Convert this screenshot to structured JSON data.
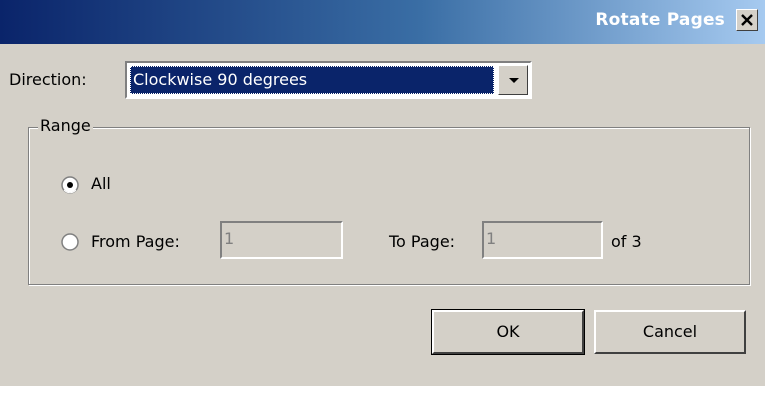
{
  "dialog": {
    "title": "Rotate Pages",
    "close_glyph": "✕"
  },
  "direction": {
    "label": "Direction:",
    "selected": "Clockwise 90 degrees"
  },
  "range": {
    "legend": "Range",
    "all_label": "All",
    "all_selected": true,
    "from_label": "From Page:",
    "from_value": "1",
    "to_label": "To Page:",
    "to_value": "1",
    "of_label": "of 3"
  },
  "buttons": {
    "ok": "OK",
    "cancel": "Cancel"
  },
  "colors": {
    "titlebar_start": "#0a246a",
    "titlebar_end": "#a6caf0",
    "face": "#d4d0c8",
    "selection": "#0a246a"
  },
  "icons": {
    "close": "close-icon",
    "dropdown": "chevron-down-icon"
  }
}
